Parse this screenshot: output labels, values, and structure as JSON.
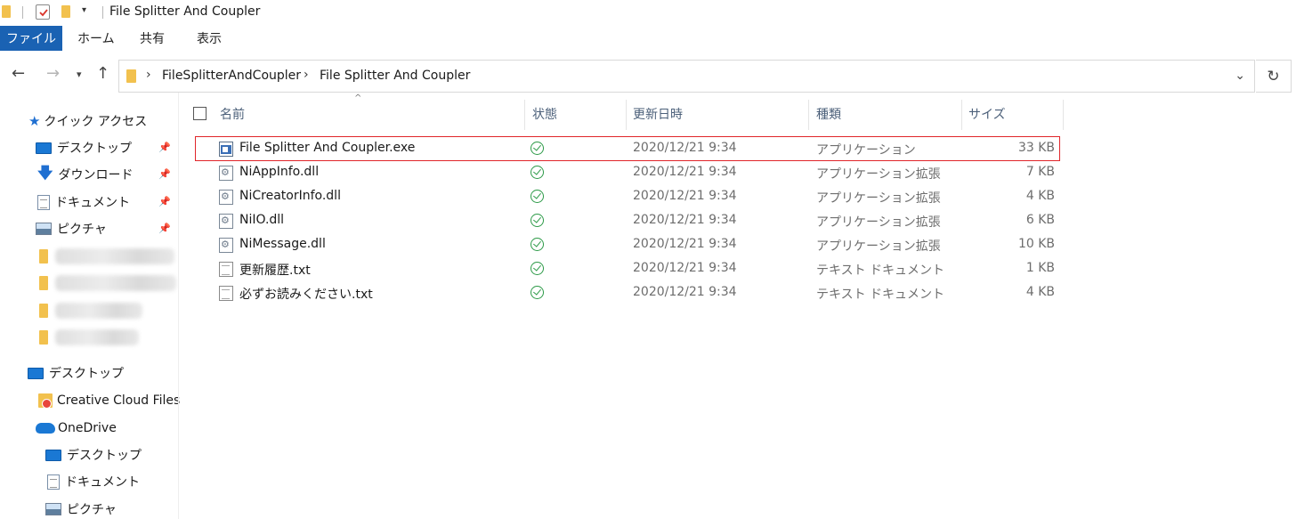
{
  "window": {
    "title": "File Splitter And Coupler"
  },
  "ribbon": {
    "tabs": [
      "ファイル",
      "ホーム",
      "共有",
      "表示"
    ]
  },
  "address": {
    "crumbs": [
      "FileSplitterAndCoupler",
      "File Splitter And Coupler"
    ]
  },
  "nav": {
    "quick_access": "クイック アクセス",
    "quick_items": [
      {
        "label": "デスクトップ",
        "icon": "desktop-icon"
      },
      {
        "label": "ダウンロード",
        "icon": "download-icon"
      },
      {
        "label": "ドキュメント",
        "icon": "document-icon"
      },
      {
        "label": "ピクチャ",
        "icon": "pictures-icon"
      }
    ],
    "desktop": "デスクトップ",
    "creative_cloud": "Creative Cloud Files",
    "onedrive": "OneDrive",
    "onedrive_items": [
      {
        "label": "デスクトップ",
        "icon": "desktop-icon"
      },
      {
        "label": "ドキュメント",
        "icon": "document-icon"
      },
      {
        "label": "ピクチャ",
        "icon": "pictures-icon"
      }
    ]
  },
  "columns": {
    "name": "名前",
    "status": "状態",
    "modified": "更新日時",
    "type": "種類",
    "size": "サイズ"
  },
  "files": [
    {
      "name": "File Splitter And Coupler.exe",
      "modified": "2020/12/21 9:34",
      "type": "アプリケーション",
      "size": "33 KB",
      "icon": "exe-icon"
    },
    {
      "name": "NiAppInfo.dll",
      "modified": "2020/12/21 9:34",
      "type": "アプリケーション拡張",
      "size": "7 KB",
      "icon": "dll-icon"
    },
    {
      "name": "NiCreatorInfo.dll",
      "modified": "2020/12/21 9:34",
      "type": "アプリケーション拡張",
      "size": "4 KB",
      "icon": "dll-icon"
    },
    {
      "name": "NiIO.dll",
      "modified": "2020/12/21 9:34",
      "type": "アプリケーション拡張",
      "size": "6 KB",
      "icon": "dll-icon"
    },
    {
      "name": "NiMessage.dll",
      "modified": "2020/12/21 9:34",
      "type": "アプリケーション拡張",
      "size": "10 KB",
      "icon": "dll-icon"
    },
    {
      "name": "更新履歴.txt",
      "modified": "2020/12/21 9:34",
      "type": "テキスト ドキュメント",
      "size": "1 KB",
      "icon": "text-file-icon"
    },
    {
      "name": "必ずお読みください.txt",
      "modified": "2020/12/21 9:34",
      "type": "テキスト ドキュメント",
      "size": "4 KB",
      "icon": "text-file-icon"
    }
  ],
  "colors": {
    "accent": "#1a62b3",
    "highlight": "#e0252a",
    "status_ok": "#2c9a47",
    "folder": "#f2c14e"
  }
}
